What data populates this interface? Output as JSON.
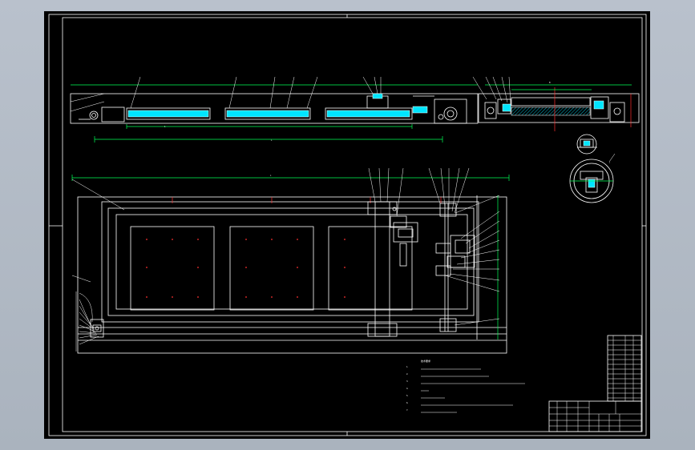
{
  "drawing": {
    "notes_title": "技术要求",
    "notes": [
      "1.",
      "2.",
      "3.",
      "4.",
      "5.",
      "6.",
      "7."
    ],
    "title_block": {
      "drawing_name": ""
    }
  }
}
